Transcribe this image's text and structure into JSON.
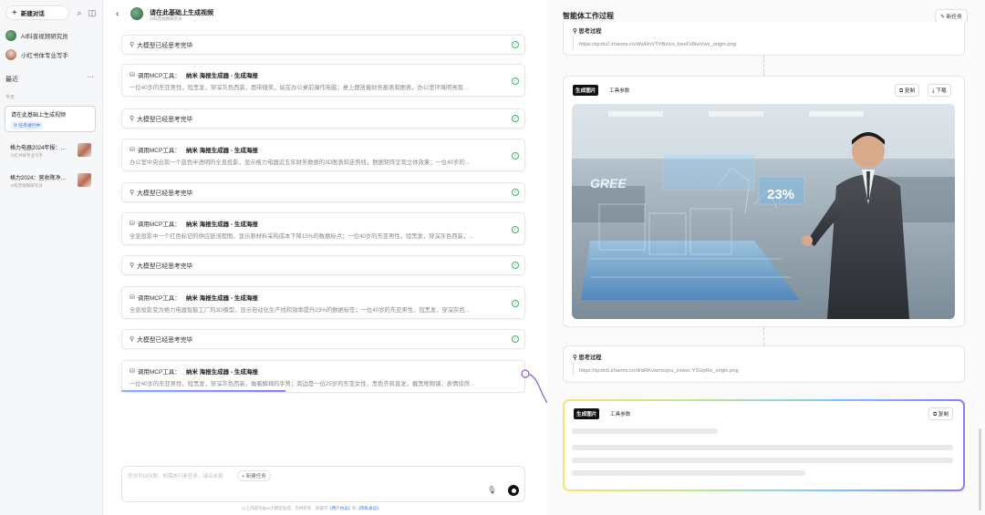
{
  "sidebar": {
    "new_chat_label": "新建对话",
    "agents": [
      {
        "name": "AI科普视频研究员"
      },
      {
        "name": "小红书体专业写手"
      }
    ],
    "recent_label": "最近",
    "more_label": "···",
    "today_label": "今天",
    "conversations": [
      {
        "title": "请在此基础上生成视频",
        "status": "任务进行中"
      },
      {
        "title": "格力电器2024年报：营...",
        "subtitle": "小红书体专业写手"
      },
      {
        "title": "格力2024：营收降净利...",
        "subtitle": "AI科普视频研究员"
      }
    ]
  },
  "header": {
    "title": "请在此基础上生成视频",
    "subtitle": "AI科普视频研究员"
  },
  "steps": [
    {
      "type": "think",
      "label": "大模型已经思考完毕"
    },
    {
      "type": "mcp",
      "label": "调用MCP工具：",
      "tool": "纳米 海报生成器 - 生成海报",
      "desc": "一位40岁的东亚男性，短黑发，穿深灰色西装，面带微笑，站在办公桌前操作电脑；桌上摆放着财务报表和图表，办公室环境明亮现..."
    },
    {
      "type": "think",
      "label": "大模型已经思考完毕"
    },
    {
      "type": "mcp",
      "label": "调用MCP工具：",
      "tool": "纳米 海报生成器 - 生成海报",
      "desc": "办公室中央出现一个蓝色半透明的全息投影，显示格力电器近五年财务数据的3D图表和走势线，数据矩阵呈现立体效果；一位40岁的..."
    },
    {
      "type": "think",
      "label": "大模型已经思考完毕"
    },
    {
      "type": "mcp",
      "label": "调用MCP工具：",
      "tool": "纳米 海报生成器 - 生成海报",
      "desc": "全息投影中一个红色标记的供应链流程图，显示原材料采购成本下降15%的数据标点；一位40岁的东亚男性，短黑发，穿深灰色西装，..."
    },
    {
      "type": "think",
      "label": "大模型已经思考完毕"
    },
    {
      "type": "mcp",
      "label": "调用MCP工具：",
      "tool": "纳米 海报生成器 - 生成海报",
      "desc": "全息投影变为格力电器智能工厂的3D模型，显示自动化生产线和效率提升23%的数据标签；一位40岁的东亚男性，短黑发，穿深灰色..."
    },
    {
      "type": "think",
      "label": "大模型已经思考完毕"
    },
    {
      "type": "mcp",
      "label": "调用MCP工具：",
      "tool": "纳米 海报生成器 - 生成海报",
      "desc": "一位40岁的东亚男性，短黑发，穿深灰色西装，做着解释的手势；旁边是一位25岁的东亚女性，黑色齐肩直发，戴黑框眼镜，表情惊然..."
    }
  ],
  "input": {
    "placeholder": "您也可以问题、知需执行新任务，请点击按",
    "new_task_label": "+ 新建任务",
    "footer_prefix": "以上内容均由AI大模型生成，仅供参考　请遵守",
    "footer_link1": "《用户协议》",
    "footer_mid": "和",
    "footer_link2": "《隐私协议》"
  },
  "right_panel": {
    "title": "智能体工作过程",
    "new_task_label": "新任务",
    "think_label": "思考过程",
    "url1": "https://qcdn2.zhaomi.cn/d/wRnVTVBzIvs_bavFz8iwVws_origin.png",
    "gen_tag": "生成图片",
    "params_tab": "工具参数",
    "copy_label": "复制",
    "download_label": "下载",
    "image_percent": "23%",
    "image_brand": "GREE",
    "url2": "https://qcdn5.zhaomi.cn/d/aRKvwroszpv_zvwsc YSUpRe_origin.png"
  },
  "colors": {
    "accent": "#3573e6",
    "success": "#3bb56b",
    "tag_bg": "#111111"
  }
}
